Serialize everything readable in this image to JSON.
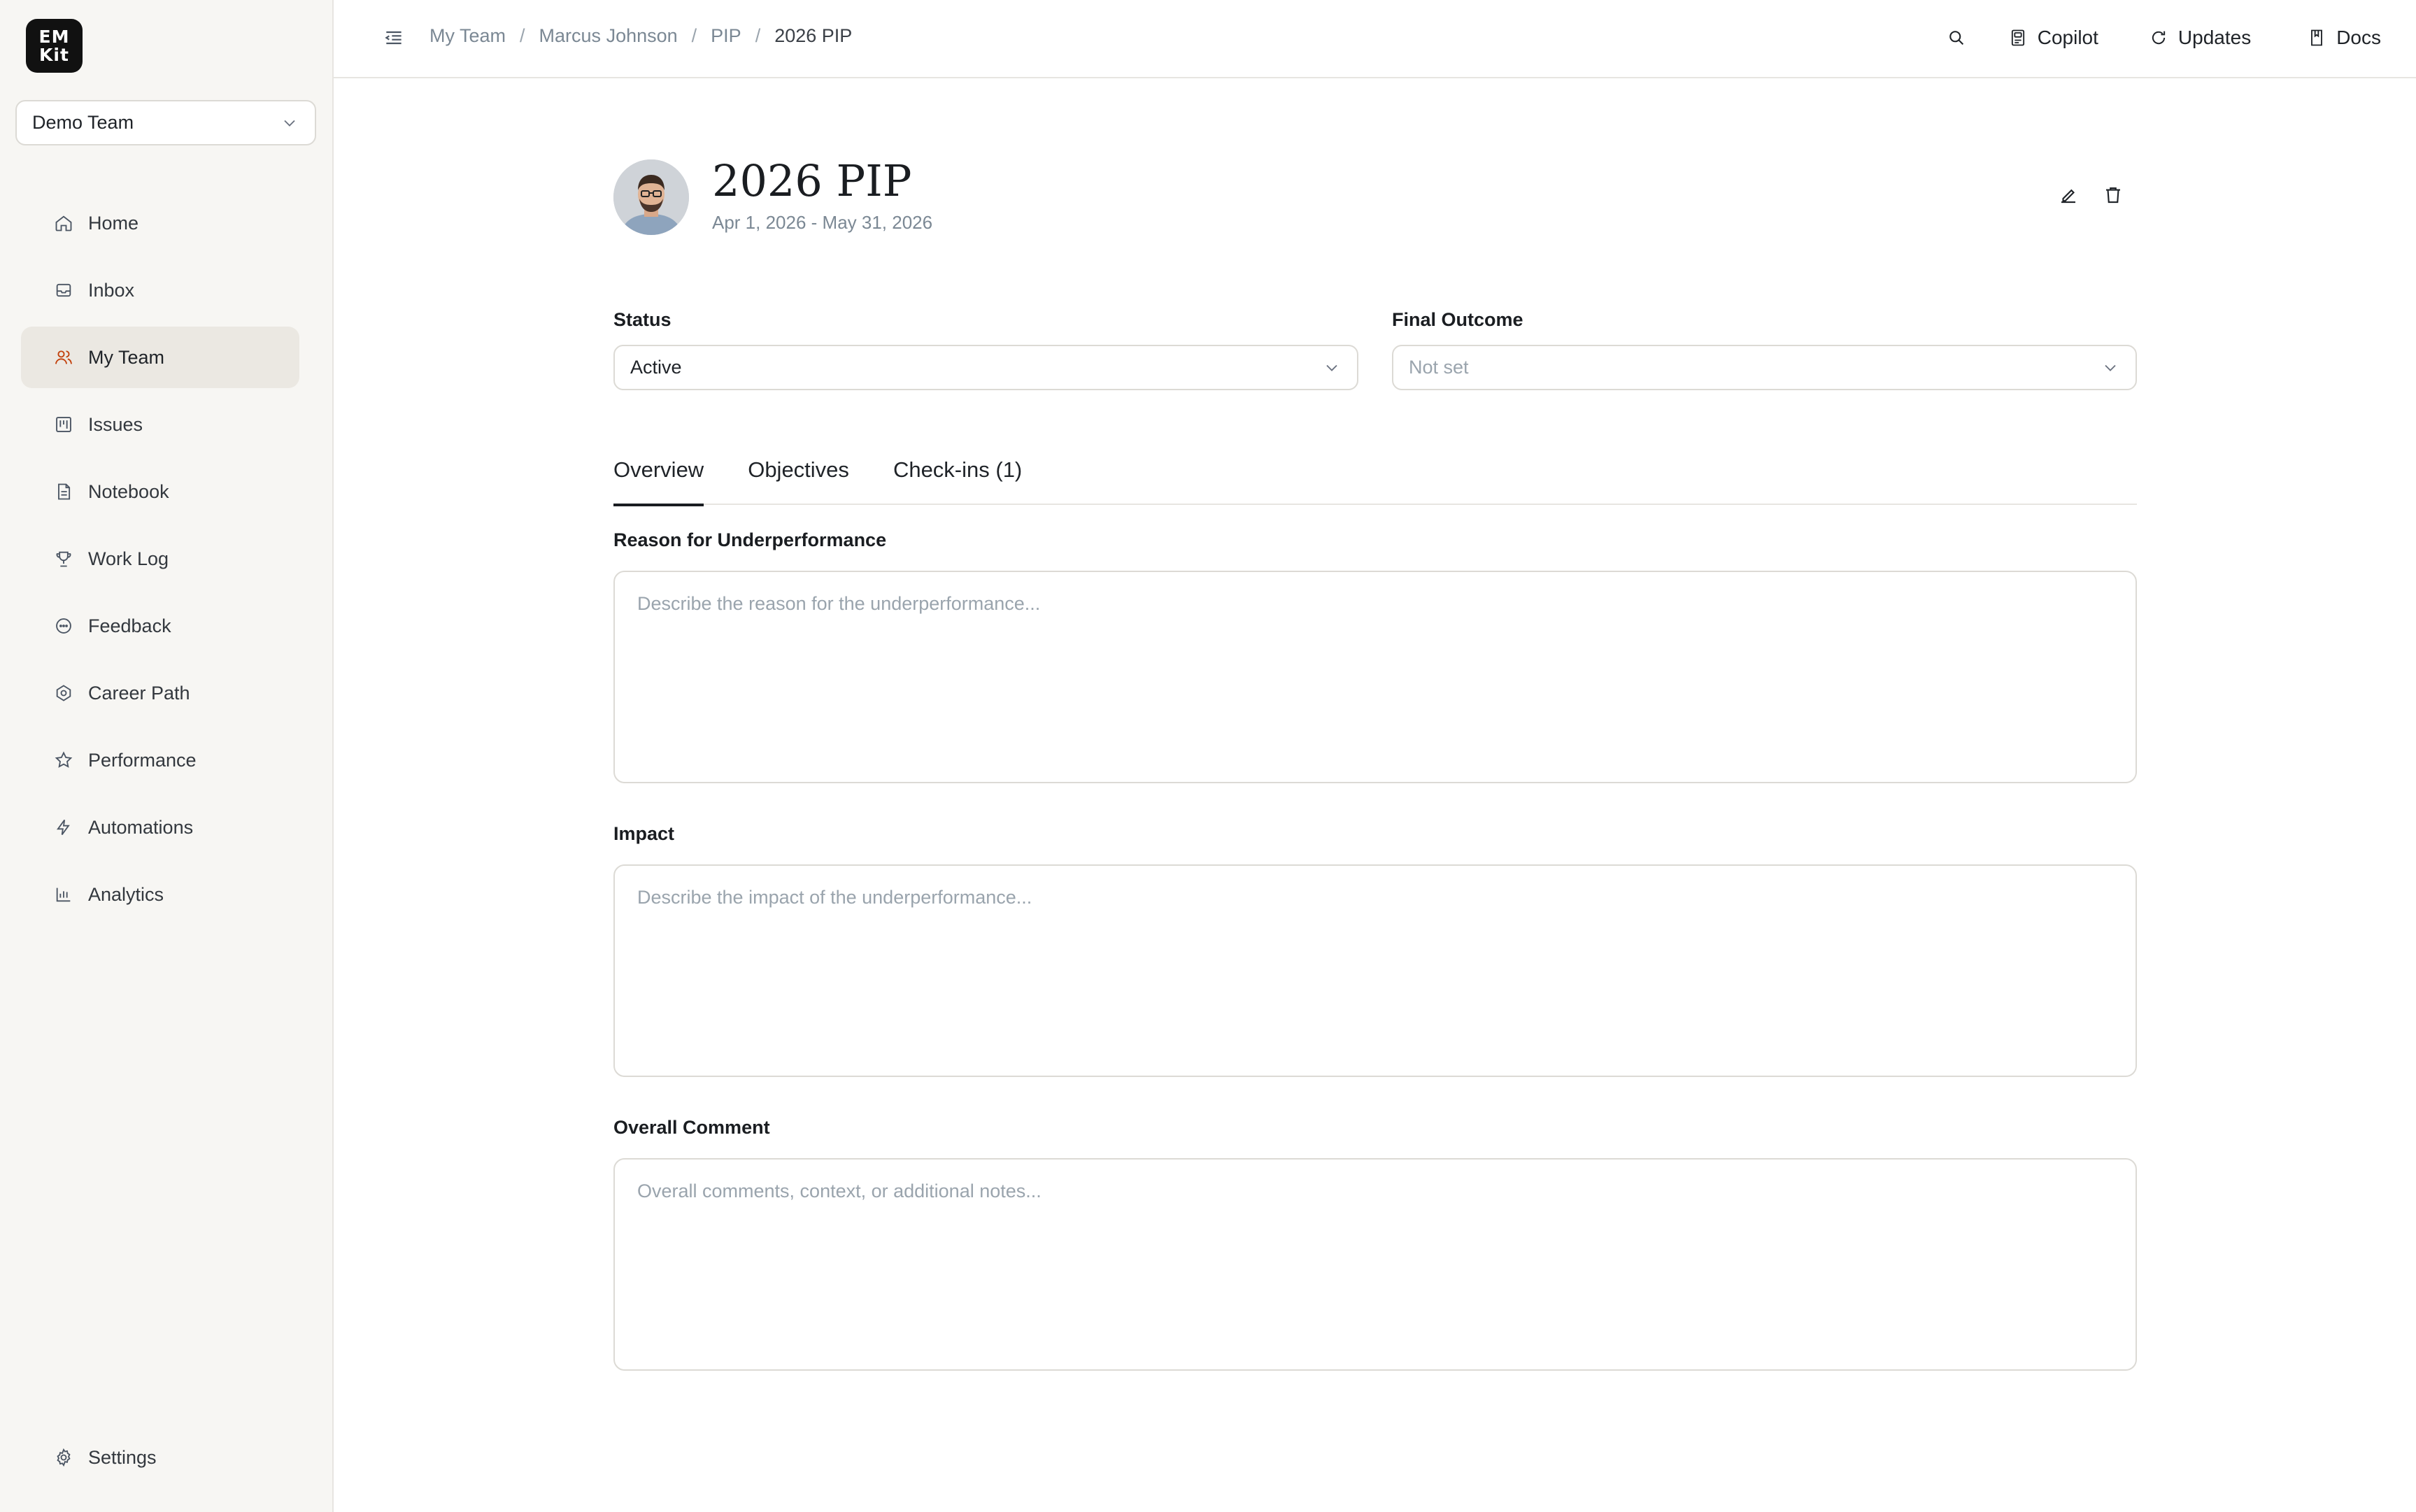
{
  "app": {
    "logo_line1": "EM",
    "logo_line2": "Kit",
    "team_selector": "Demo Team"
  },
  "sidebar": {
    "items": [
      {
        "label": "Home",
        "icon": "home-icon"
      },
      {
        "label": "Inbox",
        "icon": "inbox-icon"
      },
      {
        "label": "My Team",
        "icon": "users-icon",
        "active": true
      },
      {
        "label": "Issues",
        "icon": "kanban-icon"
      },
      {
        "label": "Notebook",
        "icon": "notebook-icon"
      },
      {
        "label": "Work Log",
        "icon": "trophy-icon"
      },
      {
        "label": "Feedback",
        "icon": "chat-icon"
      },
      {
        "label": "Career Path",
        "icon": "career-icon"
      },
      {
        "label": "Performance",
        "icon": "star-icon"
      },
      {
        "label": "Automations",
        "icon": "bolt-icon"
      },
      {
        "label": "Analytics",
        "icon": "chart-icon"
      }
    ],
    "settings_label": "Settings"
  },
  "breadcrumb": {
    "items": [
      "My Team",
      "Marcus Johnson",
      "PIP",
      "2026 PIP"
    ],
    "separator": "/"
  },
  "topbar": {
    "copilot_label": "Copilot",
    "updates_label": "Updates",
    "docs_label": "Docs"
  },
  "pip": {
    "title": "2026 PIP",
    "date_range": "Apr 1, 2026 - May 31, 2026",
    "status_label": "Status",
    "status_value": "Active",
    "outcome_label": "Final Outcome",
    "outcome_placeholder": "Not set"
  },
  "tabs": [
    {
      "label": "Overview",
      "active": true
    },
    {
      "label": "Objectives"
    },
    {
      "label": "Check-ins (1)"
    }
  ],
  "sections": {
    "reason": {
      "label": "Reason for Underperformance",
      "placeholder": "Describe the reason for the underperformance..."
    },
    "impact": {
      "label": "Impact",
      "placeholder": "Describe the impact of the underperformance..."
    },
    "comment": {
      "label": "Overall Comment",
      "placeholder": "Overall comments, context, or additional notes..."
    }
  },
  "colors": {
    "sidebar_bg": "#f7f6f3",
    "active_nav_bg": "#ebe8e2",
    "border": "#dcdad5",
    "placeholder": "#9aa4ad",
    "muted_text": "#7b8894",
    "logo_bg": "#111111"
  }
}
